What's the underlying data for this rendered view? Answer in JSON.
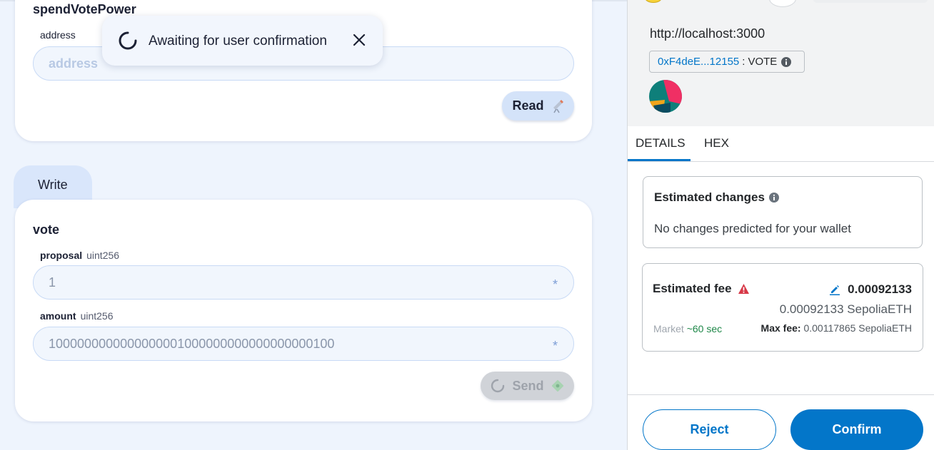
{
  "left": {
    "read_card": {
      "function_name": "spendVotePower",
      "param_label": "address",
      "input_placeholder": "address",
      "read_button": "Read"
    },
    "write_tab": "Write",
    "write_card": {
      "function_name": "vote",
      "params": [
        {
          "name": "proposal",
          "type": "uint256",
          "value": "1"
        },
        {
          "name": "amount",
          "type": "uint256",
          "value": "1000000000000000001000000000000000000100"
        }
      ],
      "required_mark": "*",
      "send_button": "Send"
    },
    "toast": {
      "message": "Awaiting for user confirmation"
    }
  },
  "wallet": {
    "origin": "http://localhost:3000",
    "address_short": "0xF4deE...12155",
    "separator": ":",
    "token": "VOTE",
    "tabs": [
      "DETAILS",
      "HEX"
    ],
    "active_tab": "DETAILS",
    "estimated_changes": {
      "title": "Estimated changes",
      "text": "No changes predicted for your wallet"
    },
    "estimated_fee": {
      "title": "Estimated fee",
      "amount": "0.00092133",
      "amount_eth": "0.00092133 SepoliaETH",
      "market_label": "Market",
      "market_time": "~60 sec",
      "max_fee_label": "Max fee:",
      "max_fee_value": "0.00117865 SepoliaETH"
    },
    "reject_button": "Reject",
    "confirm_button": "Confirm"
  },
  "colors": {
    "accent": "#0376c9",
    "warning": "#d73847",
    "market_time": "#1e8748",
    "dapp_bg": "#eef4fd"
  }
}
